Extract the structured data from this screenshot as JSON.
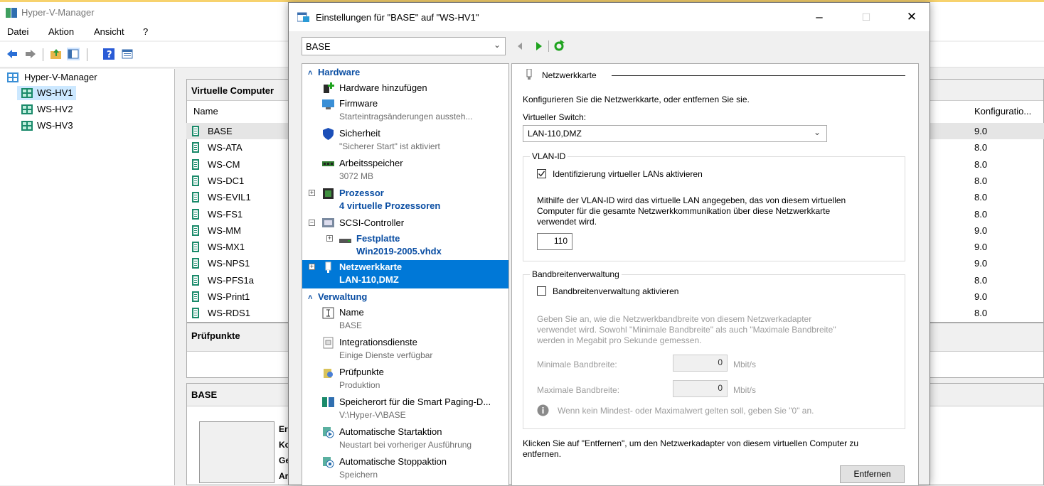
{
  "app": {
    "title": "Hyper-V-Manager",
    "menu": [
      "Datei",
      "Aktion",
      "Ansicht",
      "?"
    ],
    "toolbar_icons": [
      "back-arrow-icon",
      "forward-arrow-icon",
      "folder-up-icon",
      "console-tree-icon",
      "help-icon",
      "mmc-icon"
    ]
  },
  "tree": {
    "root": "Hyper-V-Manager",
    "servers": [
      "WS-HV1",
      "WS-HV2",
      "WS-HV3"
    ],
    "selected": "WS-HV1"
  },
  "vm_panel": {
    "header": "Virtuelle Computer",
    "col_name": "Name",
    "col_config": "Konfiguratio...",
    "rows": [
      {
        "name": "BASE",
        "config": "9.0"
      },
      {
        "name": "WS-ATA",
        "config": "8.0"
      },
      {
        "name": "WS-CM",
        "config": "8.0"
      },
      {
        "name": "WS-DC1",
        "config": "8.0"
      },
      {
        "name": "WS-EVIL1",
        "config": "8.0"
      },
      {
        "name": "WS-FS1",
        "config": "8.0"
      },
      {
        "name": "WS-MM",
        "config": "9.0"
      },
      {
        "name": "WS-MX1",
        "config": "9.0"
      },
      {
        "name": "WS-NPS1",
        "config": "9.0"
      },
      {
        "name": "WS-PFS1a",
        "config": "8.0"
      },
      {
        "name": "WS-Print1",
        "config": "9.0"
      },
      {
        "name": "WS-RDS1",
        "config": "8.0"
      }
    ]
  },
  "checkpoints_panel": {
    "header": "Prüfpunkte"
  },
  "details_panel": {
    "header": "BASE",
    "clipped_labels": [
      "Er",
      "Ko",
      "Ge",
      "Ar"
    ]
  },
  "dialog": {
    "title": "Einstellungen für \"BASE\" auf \"WS-HV1\"",
    "vm_select": "BASE",
    "sections": {
      "hardware": "Hardware",
      "management": "Verwaltung"
    },
    "hardware_items": [
      {
        "title": "Hardware hinzufügen",
        "sub": ""
      },
      {
        "title": "Firmware",
        "sub": "Starteintragsänderungen aussteh..."
      },
      {
        "title": "Sicherheit",
        "sub": "\"Sicherer Start\" ist aktiviert"
      },
      {
        "title": "Arbeitsspeicher",
        "sub": "3072 MB"
      },
      {
        "title": "Prozessor",
        "sub": "4 virtuelle Prozessoren"
      },
      {
        "title": "SCSI-Controller",
        "sub": ""
      },
      {
        "title": "Festplatte",
        "sub": "Win2019-2005.vhdx"
      },
      {
        "title": "Netzwerkkarte",
        "sub": "LAN-110,DMZ"
      }
    ],
    "management_items": [
      {
        "title": "Name",
        "sub": "BASE"
      },
      {
        "title": "Integrationsdienste",
        "sub": "Einige Dienste verfügbar"
      },
      {
        "title": "Prüfpunkte",
        "sub": "Produktion"
      },
      {
        "title": "Speicherort für die Smart Paging-D...",
        "sub": "V:\\Hyper-V\\BASE"
      },
      {
        "title": "Automatische Startaktion",
        "sub": "Neustart bei vorheriger Ausführung"
      },
      {
        "title": "Automatische Stoppaktion",
        "sub": "Speichern"
      }
    ],
    "nic": {
      "heading": "Netzwerkkarte",
      "intro": "Konfigurieren Sie die Netzwerkkarte, oder entfernen Sie sie.",
      "switch_label": "Virtueller Switch:",
      "switch_value": "LAN-110,DMZ",
      "vlan_group": "VLAN-ID",
      "vlan_checkbox": "Identifizierung virtueller LANs aktivieren",
      "vlan_checked": true,
      "vlan_desc_1": "Mithilfe der VLAN-ID wird das virtuelle LAN angegeben, das von diesem virtuellen",
      "vlan_desc_2": "Computer für die gesamte Netzwerkkommunikation über diese Netzwerkkarte",
      "vlan_desc_3": "verwendet wird.",
      "vlan_id": "110",
      "bw_group": "Bandbreitenverwaltung",
      "bw_checkbox": "Bandbreitenverwaltung aktivieren",
      "bw_checked": false,
      "bw_desc_1": "Geben Sie an, wie die Netzwerkbandbreite von diesem Netzwerkadapter",
      "bw_desc_2": "verwendet wird. Sowohl \"Minimale Bandbreite\" als auch \"Maximale Bandbreite\"",
      "bw_desc_3": "werden in Megabit pro Sekunde gemessen.",
      "min_label": "Minimale Bandbreite:",
      "min_value": "0",
      "max_label": "Maximale Bandbreite:",
      "max_value": "0",
      "unit": "Mbit/s",
      "bw_hint": "Wenn kein Mindest- oder Maximalwert gelten soll, geben Sie \"0\" an.",
      "remove_desc_1": "Klicken Sie auf \"Entfernen\", um den Netzwerkadapter von diesem virtuellen Computer zu",
      "remove_desc_2": "entfernen.",
      "remove_button": "Entfernen"
    }
  },
  "colors": {
    "accent": "#0078d7",
    "link_blue": "#0a4ea3",
    "server_green": "#1a8a6a"
  }
}
